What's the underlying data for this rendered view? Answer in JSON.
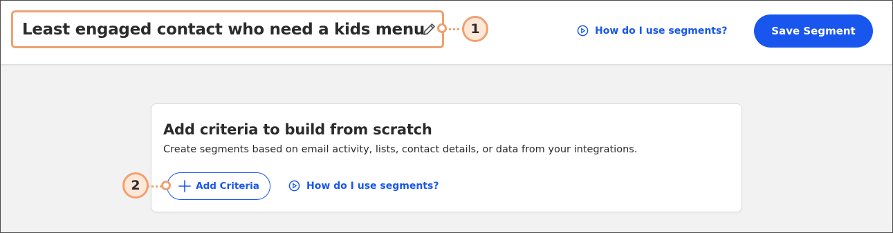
{
  "header": {
    "segment_title": "Least engaged contact who need a kids menu",
    "help_link_label": "How do I use segments?",
    "save_button_label": "Save Segment"
  },
  "card": {
    "title": "Add criteria to build from scratch",
    "description": "Create segments based on email activity, lists, contact details, or data from your integrations.",
    "add_criteria_label": "Add Criteria",
    "help_link_label": "How do I use segments?"
  },
  "callouts": [
    {
      "number": "1"
    },
    {
      "number": "2"
    }
  ],
  "icons": {
    "edit": "pencil-icon",
    "help": "play-circle-icon",
    "add": "plus-icon"
  },
  "colors": {
    "accent_blue": "#1856ed",
    "callout_orange": "#f0a070",
    "callout_fill": "#fde8d8",
    "page_background": "#f2f2f2",
    "text_dark": "#2b2b2b"
  }
}
